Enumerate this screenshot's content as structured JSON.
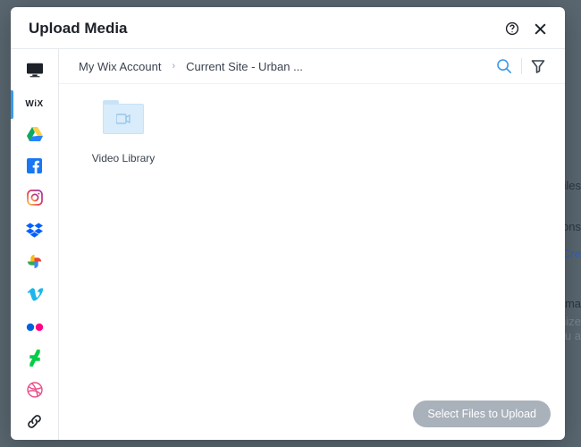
{
  "title": "Upload Media",
  "breadcrumbs": {
    "root": "My Wix Account",
    "current": "Current Site - Urban ..."
  },
  "sidebar": {
    "sources": [
      {
        "id": "upload",
        "name": "upload-icon"
      },
      {
        "id": "wix",
        "name": "wix-icon",
        "label": "WiX",
        "selected": true
      },
      {
        "id": "gdrive",
        "name": "google-drive-icon"
      },
      {
        "id": "facebook",
        "name": "facebook-icon"
      },
      {
        "id": "instagram",
        "name": "instagram-icon"
      },
      {
        "id": "dropbox",
        "name": "dropbox-icon"
      },
      {
        "id": "gphotos",
        "name": "google-photos-icon"
      },
      {
        "id": "vimeo",
        "name": "vimeo-icon"
      },
      {
        "id": "flickr",
        "name": "flickr-icon"
      },
      {
        "id": "deviantart",
        "name": "deviantart-icon"
      },
      {
        "id": "dribbble",
        "name": "dribbble-icon"
      },
      {
        "id": "url",
        "name": "link-icon"
      }
    ]
  },
  "content": {
    "items": [
      {
        "type": "folder",
        "label": "Video Library",
        "icon": "video"
      }
    ]
  },
  "actions": {
    "upload_button": "Select Files to Upload"
  },
  "background_fragments": {
    "a": "Files",
    "b": "ons",
    "c": "Cre",
    "d": "rma",
    "e": "nize",
    "f": "ou a"
  }
}
